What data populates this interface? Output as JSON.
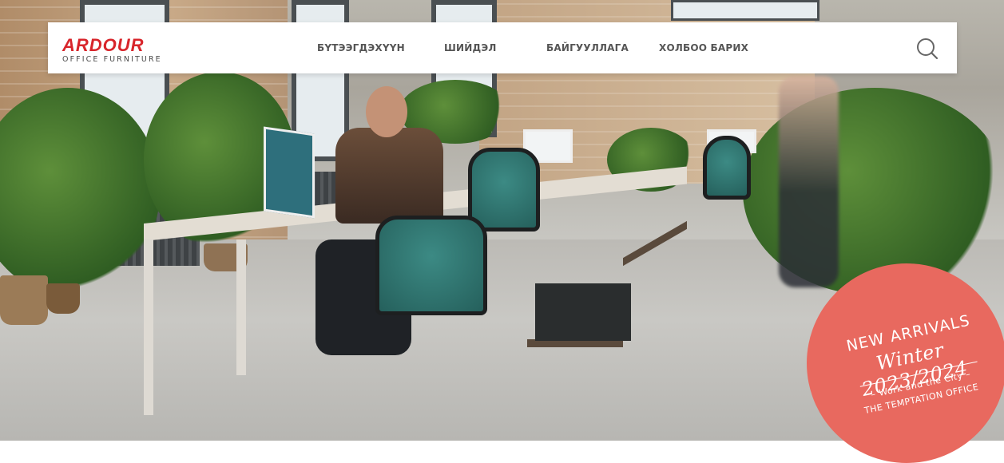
{
  "brand": {
    "name": "ARDOUR",
    "tagline": "OFFICE FURNITURE",
    "color": "#d8252b"
  },
  "nav": {
    "items": [
      {
        "label": "БҮТЭЭГДЭХҮҮН"
      },
      {
        "label": "ШИЙДЭЛ"
      },
      {
        "label": "БАЙГУУЛЛАГА"
      },
      {
        "label": "ХОЛБОО БАРИХ"
      }
    ],
    "search_icon": "search-icon"
  },
  "hero": {
    "image_description": "open-plan office with desks, green mesh chairs and plants"
  },
  "promo": {
    "line1": "NEW ARRIVALS",
    "line2": "Winter 2023/2024",
    "line3": "– Work and the City –",
    "line4": "THE TEMPTATION OFFICE",
    "color": "#e8695f"
  }
}
